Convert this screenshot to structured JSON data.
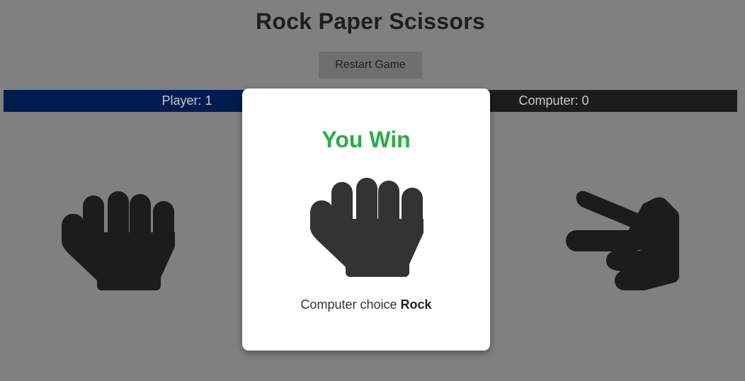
{
  "header": {
    "title": "Rock Paper Scissors"
  },
  "controls": {
    "restart_label": "Restart Game"
  },
  "scoreboard": {
    "player_label": "Player: 1",
    "computer_label": "Computer: 0"
  },
  "choices": [
    {
      "name": "rock",
      "icon": "rock-fist-icon"
    },
    {
      "name": "scissors",
      "icon": "scissors-hand-icon"
    }
  ],
  "modal": {
    "result_title": "You Win",
    "result_color": "#2aab46",
    "result_icon": "rock-fist-icon",
    "message_prefix": "Computer choice",
    "computer_choice": "Rock"
  },
  "colors": {
    "background": "#808080",
    "player_bar": "#001b50",
    "computer_bar": "#1c1c1c",
    "icon_dark": "#1c1c1c",
    "modal_icon": "#333333"
  }
}
